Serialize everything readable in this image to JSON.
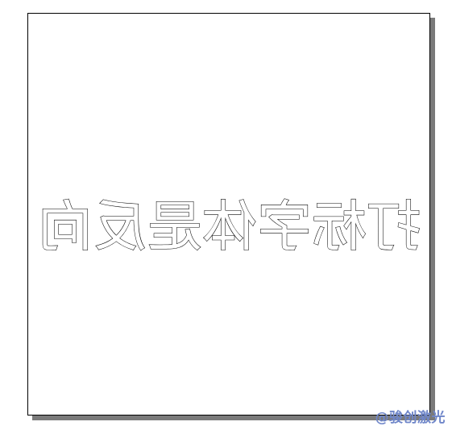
{
  "canvas": {
    "mirrored_text": "打标字体是反向"
  },
  "watermark": {
    "text": "@骏创激光"
  },
  "colors": {
    "page": "#ffffff",
    "outline": "#000000",
    "shadow": "#7a7a7a",
    "watermark": "#6f86c9"
  }
}
